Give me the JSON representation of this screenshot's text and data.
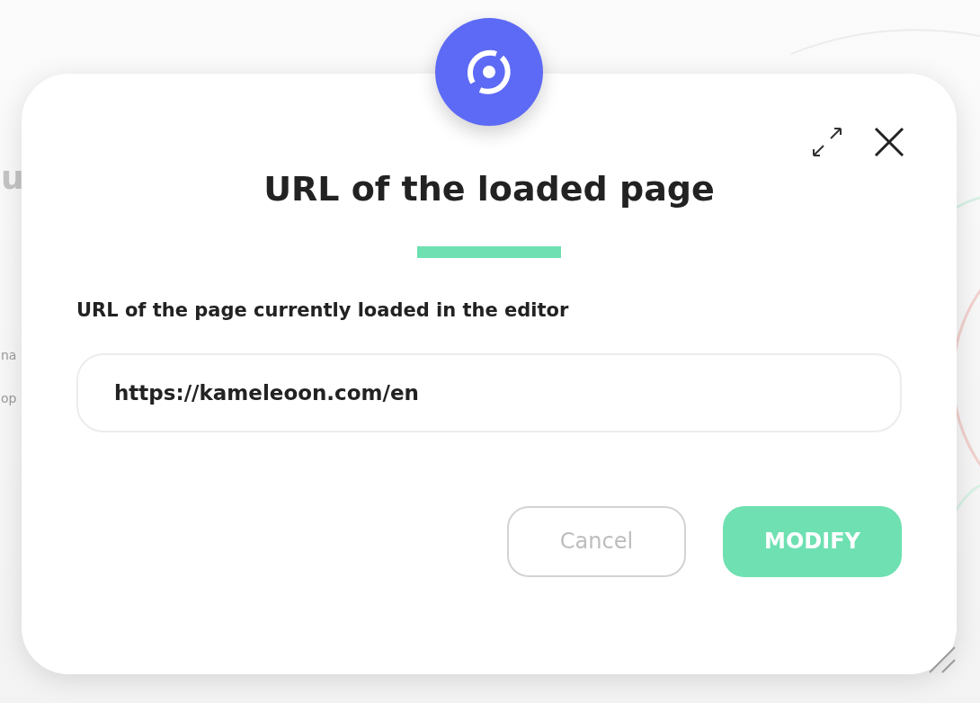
{
  "background": {
    "fragments": [
      "u",
      "na",
      "op"
    ]
  },
  "dialog": {
    "title": "URL of the loaded page",
    "field_label": "URL of the page currently loaded in the editor",
    "url_field": {
      "value": "https://kameleoon.com/en"
    },
    "buttons": [
      {
        "kind": "secondary",
        "label": "Cancel"
      },
      {
        "kind": "primary",
        "label": "MODIFY"
      }
    ]
  }
}
